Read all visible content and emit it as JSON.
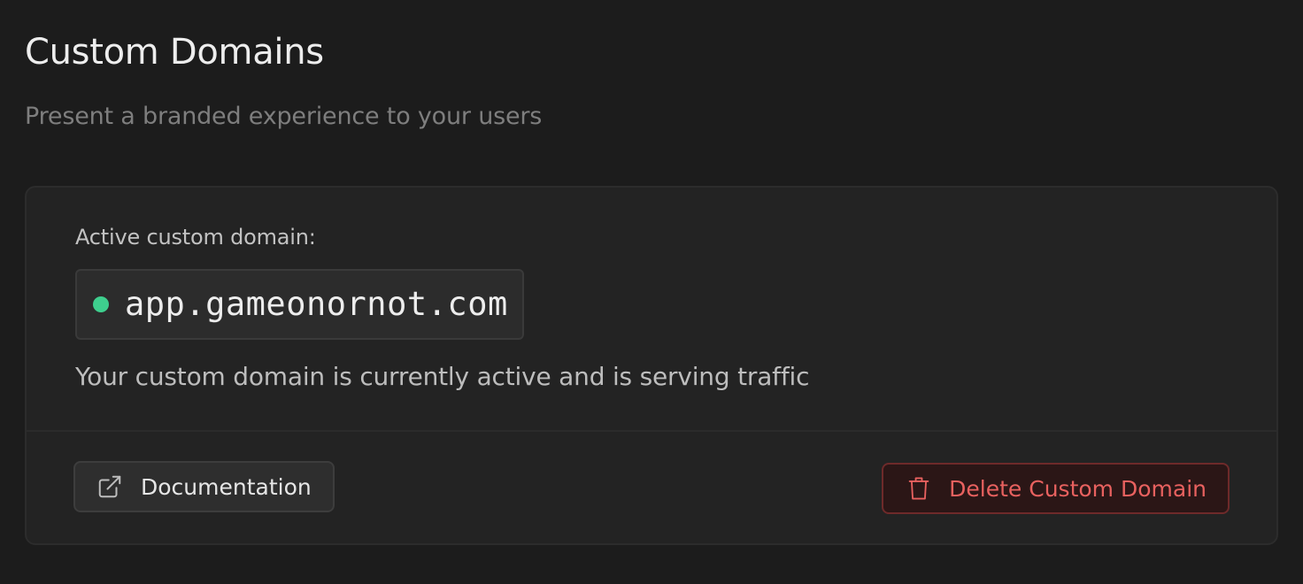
{
  "header": {
    "title": "Custom Domains",
    "subtitle": "Present a branded experience to your users"
  },
  "card": {
    "label": "Active custom domain:",
    "domain": "app.gameonornot.com",
    "status": "active",
    "status_color": "#3ecf8e",
    "description": "Your custom domain is currently active and is serving traffic"
  },
  "footer": {
    "documentation_label": "Documentation",
    "documentation_icon": "external-link-icon",
    "delete_label": "Delete Custom Domain",
    "delete_icon": "trash-icon",
    "delete_color": "#e8615f"
  }
}
